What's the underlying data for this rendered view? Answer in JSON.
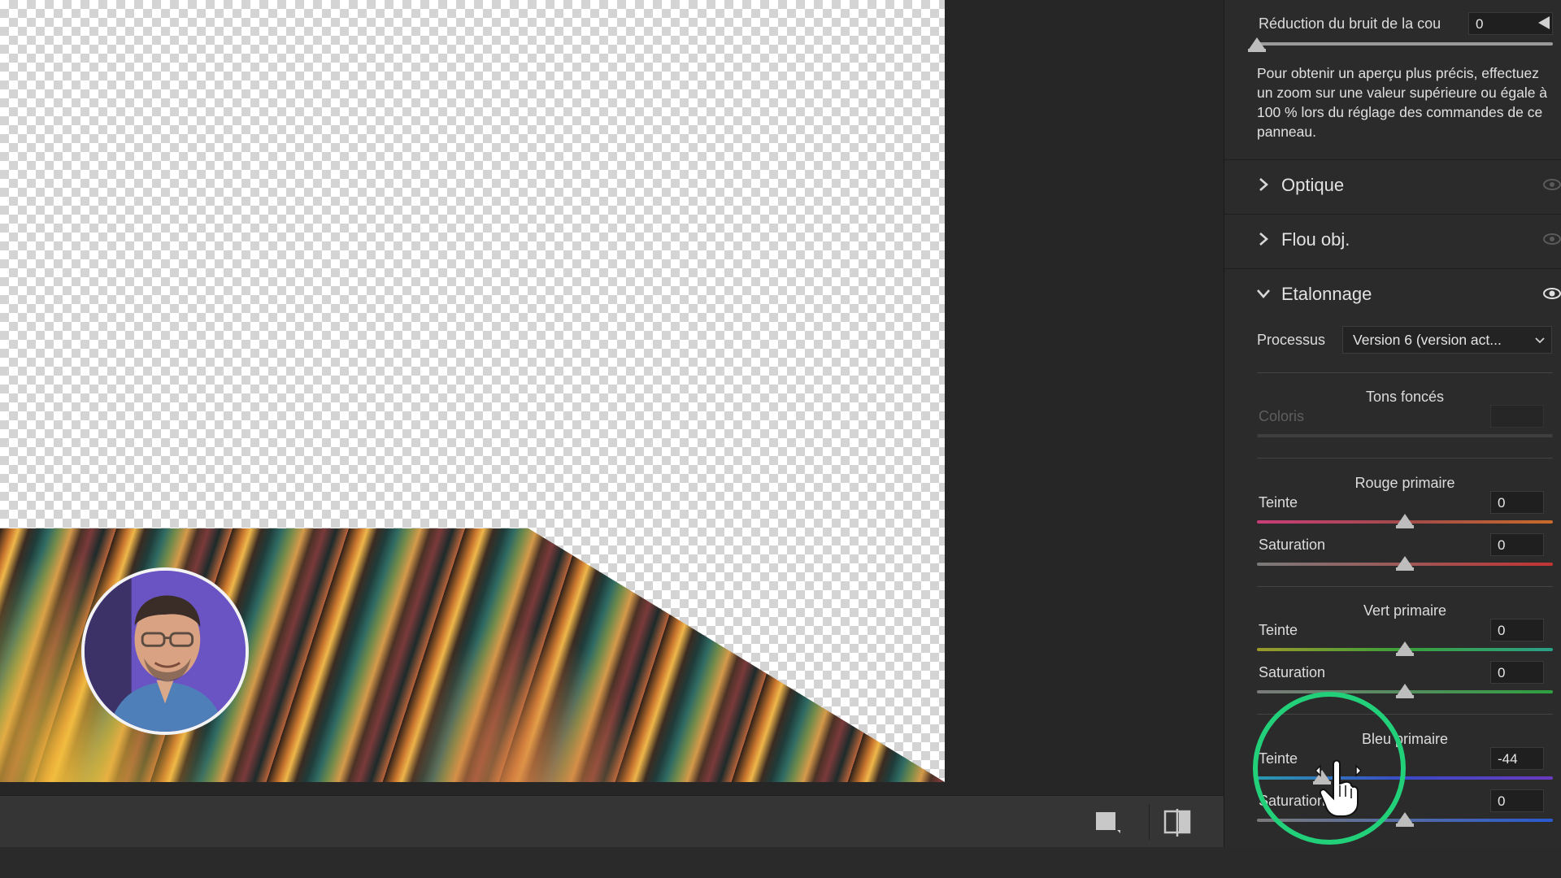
{
  "noise": {
    "label": "Réduction du bruit de la cou",
    "value": "0",
    "note": "Pour obtenir un aperçu plus précis, effectuez un zoom sur une valeur supérieure ou égale à 100 % lors du réglage des commandes de ce panneau."
  },
  "sections": {
    "optique": "Optique",
    "flou": "Flou obj.",
    "etalonnage": "Etalonnage"
  },
  "calibration": {
    "process_label": "Processus",
    "process_value": "Version 6 (version act...",
    "shadows": {
      "title": "Tons foncés",
      "tint_label": "Coloris",
      "tint_value": ""
    },
    "red": {
      "title": "Rouge primaire",
      "hue_label": "Teinte",
      "hue_value": "0",
      "sat_label": "Saturation",
      "sat_value": "0"
    },
    "green": {
      "title": "Vert primaire",
      "hue_label": "Teinte",
      "hue_value": "0",
      "sat_label": "Saturation",
      "sat_value": "0"
    },
    "blue": {
      "title": "Bleu primaire",
      "hue_label": "Teinte",
      "hue_value": "-44",
      "sat_label": "Saturation",
      "sat_value": "0"
    }
  },
  "slider_levels": {
    "noise": 0.0,
    "red_hue": 0.5,
    "red_sat": 0.5,
    "green_hue": 0.5,
    "green_sat": 0.5,
    "blue_hue": 0.22,
    "blue_sat": 0.5
  },
  "icons": {
    "single_view": "single-view-icon",
    "split_view": "split-view-icon",
    "expand": "chevron-right-icon",
    "collapse": "chevron-down-icon",
    "visibility": "eye-icon",
    "panel_menu": "triangle-left-icon",
    "cursor": "hand-cursor-icon"
  },
  "colors": {
    "highlight_ring": "#22d07a",
    "panel_bg": "#2b2b2b",
    "field_bg": "#1f1f1f"
  }
}
